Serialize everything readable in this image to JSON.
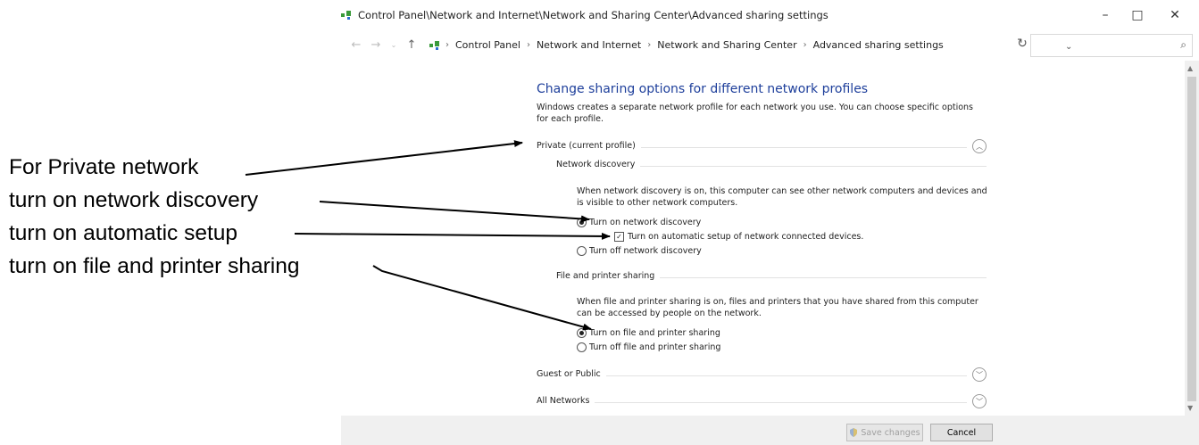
{
  "window": {
    "title": "Control Panel\\Network and Internet\\Network and Sharing Center\\Advanced sharing settings",
    "controls": {
      "minimize": "–",
      "maximize": "□",
      "close": "✕"
    }
  },
  "nav": {
    "back": "←",
    "forward": "→",
    "up": "↑",
    "dropdown": "⌄",
    "refresh": "↻"
  },
  "breadcrumb": [
    "Control Panel",
    "Network and Internet",
    "Network and Sharing Center",
    "Advanced sharing settings"
  ],
  "search": {
    "placeholder": "",
    "icon": "search-icon"
  },
  "content": {
    "heading": "Change sharing options for different network profiles",
    "intro": "Windows creates a separate network profile for each network you use. You can choose specific options for each profile.",
    "private": {
      "label": "Private (current profile)",
      "network_discovery": {
        "title": "Network discovery",
        "description": "When network discovery is on, this computer can see other network computers and devices and is visible to other network computers.",
        "on": "Turn on network discovery",
        "auto_setup": "Turn on automatic setup of network connected devices.",
        "off": "Turn off network discovery"
      },
      "file_sharing": {
        "title": "File and printer sharing",
        "description": "When file and printer sharing is on, files and printers that you have shared from this computer can be accessed by people on the network.",
        "on": "Turn on file and printer sharing",
        "off": "Turn off file and printer sharing"
      }
    },
    "guest": {
      "label": "Guest or Public"
    },
    "all": {
      "label": "All Networks"
    }
  },
  "footer": {
    "save": "Save changes",
    "cancel": "Cancel"
  },
  "annotations": [
    "For Private network",
    "turn on network discovery",
    "turn on automatic setup",
    "turn on file and printer sharing"
  ]
}
